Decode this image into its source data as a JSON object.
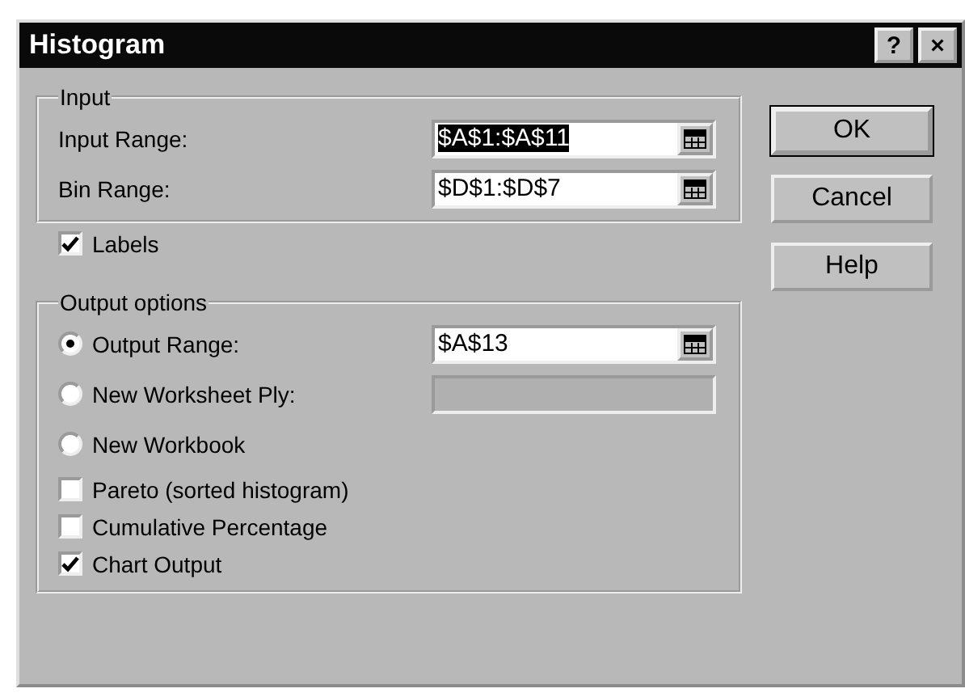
{
  "window": {
    "title": "Histogram",
    "title_buttons": [
      "?",
      "×"
    ]
  },
  "input": {
    "title": "Input",
    "fields": [
      {
        "label": "Input Range:",
        "value": "$A$1:$A$11",
        "text_selected": true
      },
      {
        "label": "Bin Range:",
        "value": "$D$1:$D$7",
        "text_selected": false
      }
    ],
    "labels_checkbox": {
      "label": "Labels",
      "checked": true
    }
  },
  "output_options": {
    "title": "Output options",
    "radios": [
      {
        "label": "Output Range:",
        "selected": true,
        "field": {
          "value": "$A$13",
          "disabled": false,
          "has_picker": true
        }
      },
      {
        "label": "New Worksheet Ply:",
        "selected": false,
        "field": {
          "disabled": true,
          "has_picker": false
        }
      },
      {
        "label": "New Workbook",
        "selected": false
      }
    ],
    "checkboxes": [
      {
        "label": "Pareto (sorted histogram)",
        "checked": false
      },
      {
        "label": "Cumulative Percentage",
        "checked": false
      },
      {
        "label": "Chart Output",
        "checked": true
      }
    ]
  },
  "buttons": [
    {
      "label": "OK",
      "default": true
    },
    {
      "label": "Cancel",
      "default": false
    },
    {
      "label": "Help",
      "default": false
    }
  ]
}
